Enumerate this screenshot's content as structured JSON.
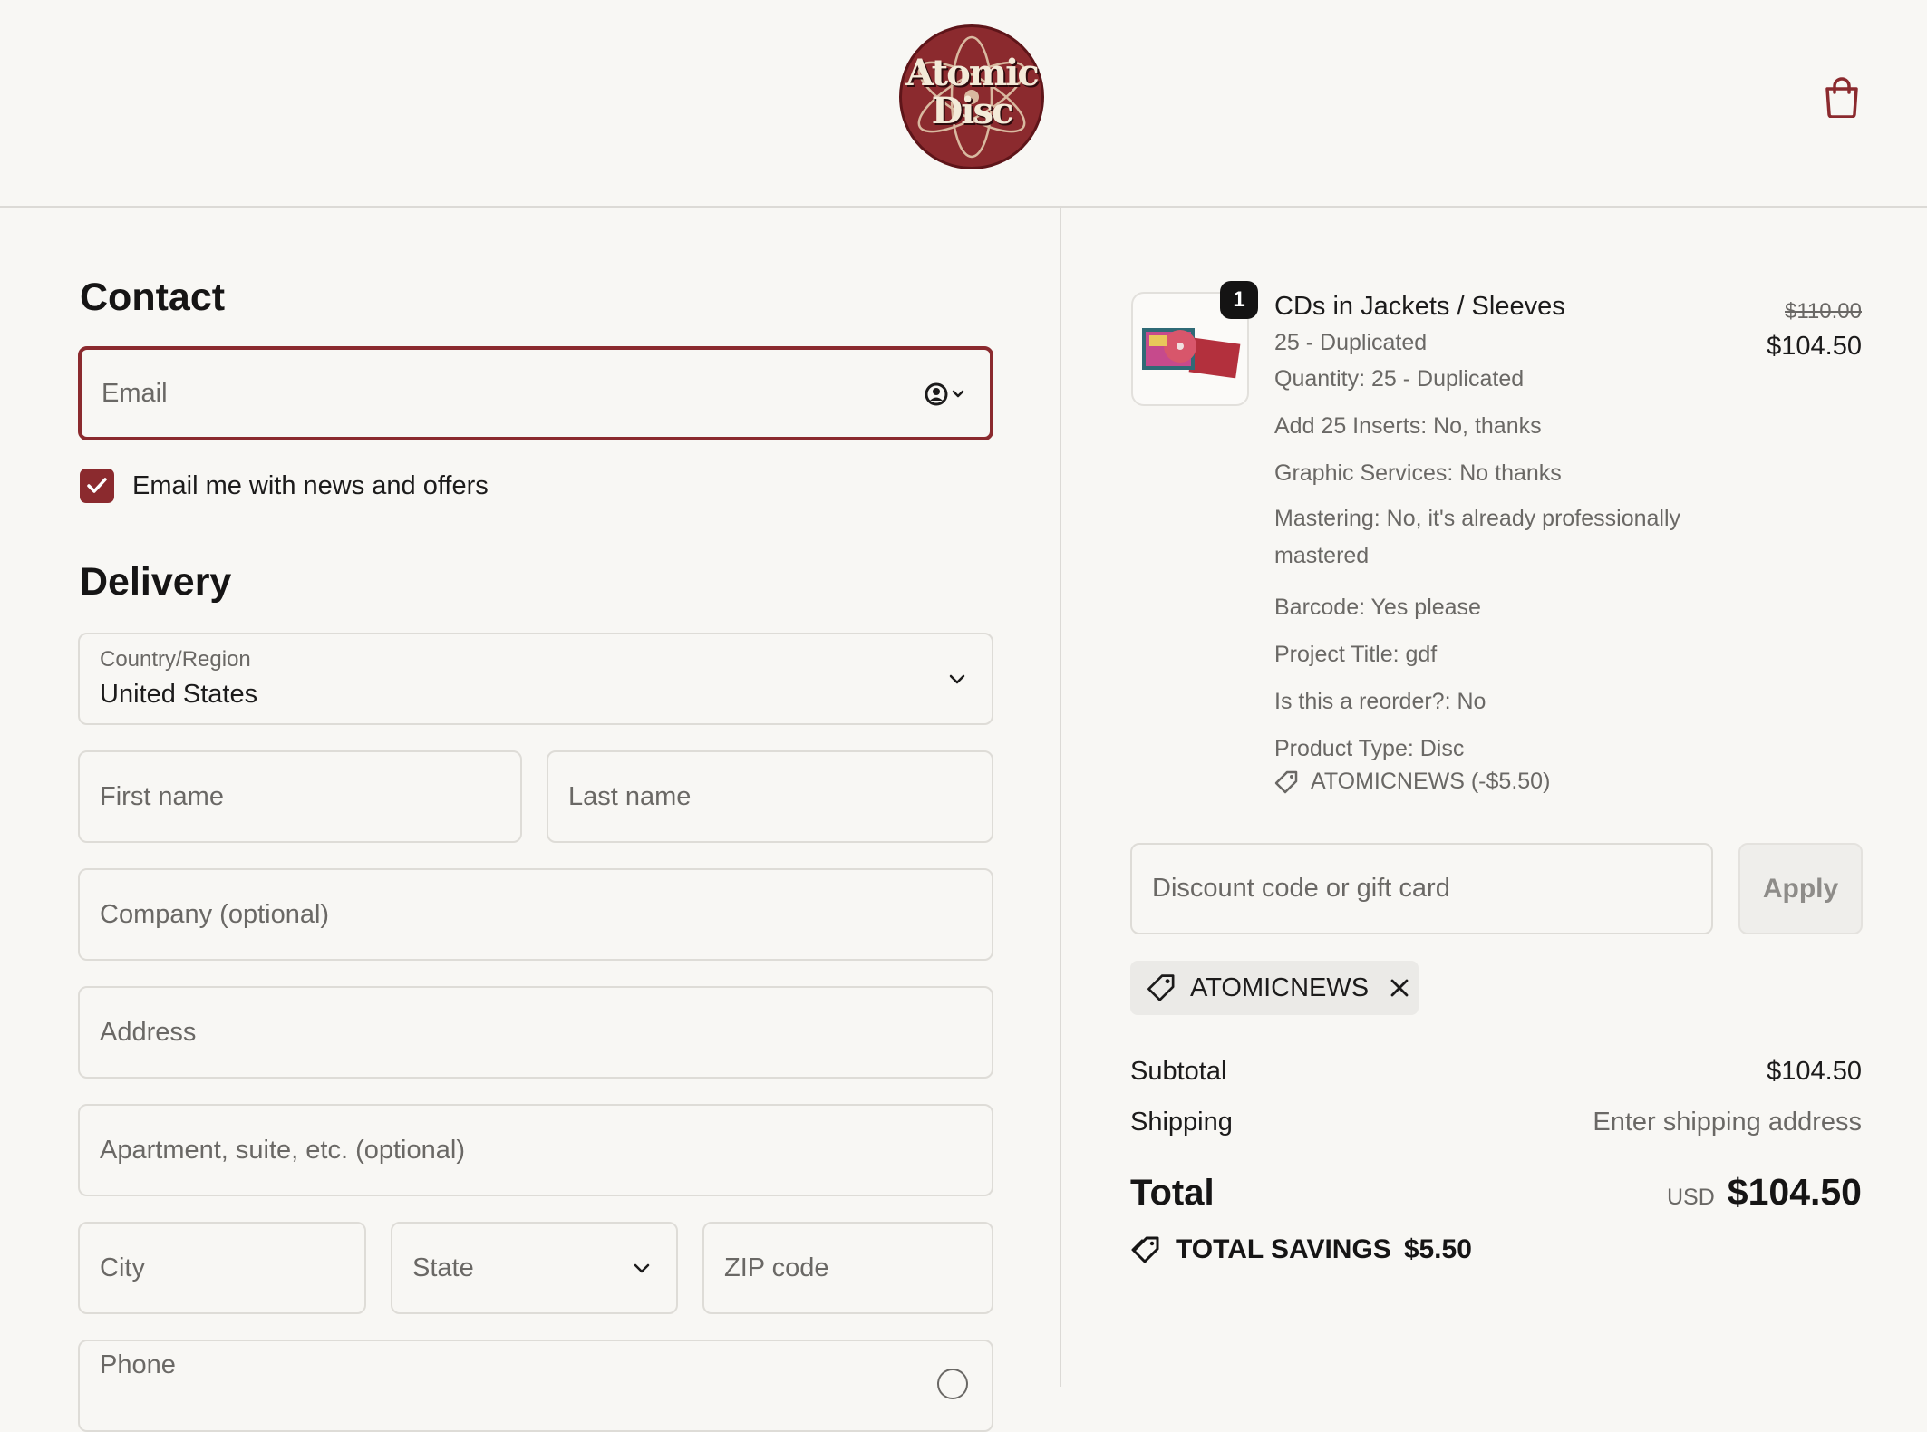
{
  "brand": {
    "logo_text_line1": "Atomic",
    "logo_text_line2": "Disc",
    "accent_color": "#8b2a2e"
  },
  "header": {
    "cart_icon": "shopping-bag-icon"
  },
  "contact": {
    "title": "Contact",
    "email_placeholder": "Email",
    "newsletter_label": "Email me with news and offers",
    "newsletter_checked": true
  },
  "delivery": {
    "title": "Delivery",
    "country_label": "Country/Region",
    "country_value": "United States",
    "first_name_placeholder": "First name",
    "last_name_placeholder": "Last name",
    "company_placeholder": "Company (optional)",
    "address_placeholder": "Address",
    "apartment_placeholder": "Apartment, suite, etc. (optional)",
    "city_placeholder": "City",
    "state_placeholder": "State",
    "zip_placeholder": "ZIP code",
    "phone_placeholder": "Phone"
  },
  "order": {
    "item": {
      "quantity_badge": "1",
      "title": "CDs in Jackets / Sleeves",
      "variant": "25 - Duplicated",
      "options": [
        "Quantity: 25 - Duplicated",
        "Add 25 Inserts: No, thanks",
        "Graphic Services: No thanks",
        "Mastering: No, it's already professionally mastered",
        "Barcode: Yes please",
        "Project Title: gdf",
        "Is this a reorder?: No",
        "Product Type: Disc"
      ],
      "discount_line": "ATOMICNEWS (-$5.50)",
      "price_original": "$110.00",
      "price_final": "$104.50"
    },
    "discount_placeholder": "Discount code or gift card",
    "apply_label": "Apply",
    "applied_code": "ATOMICNEWS",
    "subtotal_label": "Subtotal",
    "subtotal_value": "$104.50",
    "shipping_label": "Shipping",
    "shipping_value": "Enter shipping address",
    "total_label": "Total",
    "total_currency": "USD",
    "total_value": "$104.50",
    "savings_label": "TOTAL SAVINGS",
    "savings_value": "$5.50"
  }
}
